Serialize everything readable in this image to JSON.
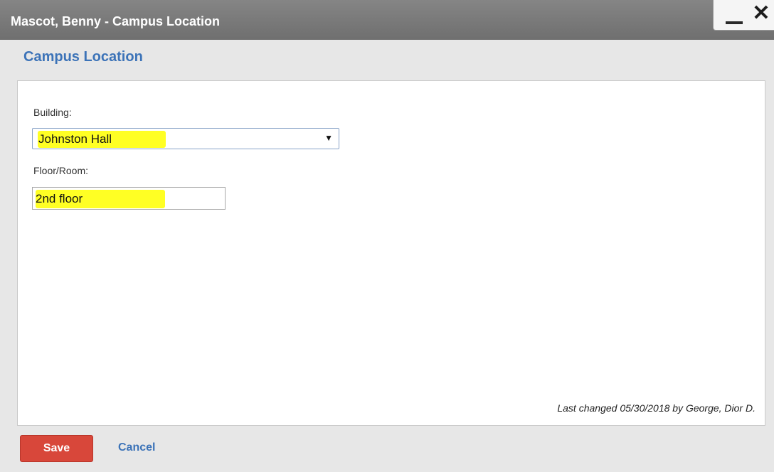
{
  "window": {
    "title": "Mascot, Benny - Campus Location",
    "minimize_icon": "minimize-icon",
    "close_icon": "close-icon",
    "close_glyph": "✕"
  },
  "section": {
    "title": "Campus Location"
  },
  "form": {
    "building": {
      "label": "Building:",
      "selected_value": "Johnston Hall",
      "arrow_glyph": "▼"
    },
    "floor_room": {
      "label": "Floor/Room:",
      "value": "2nd floor"
    }
  },
  "footer": {
    "last_changed": "Last changed 05/30/2018 by George, Dior D.",
    "save_label": "Save",
    "cancel_label": "Cancel"
  },
  "colors": {
    "title_bar": "#7a7a7a",
    "accent_blue": "#3c73b8",
    "save_red": "#d8473a",
    "highlight_yellow": "#ffff24"
  }
}
